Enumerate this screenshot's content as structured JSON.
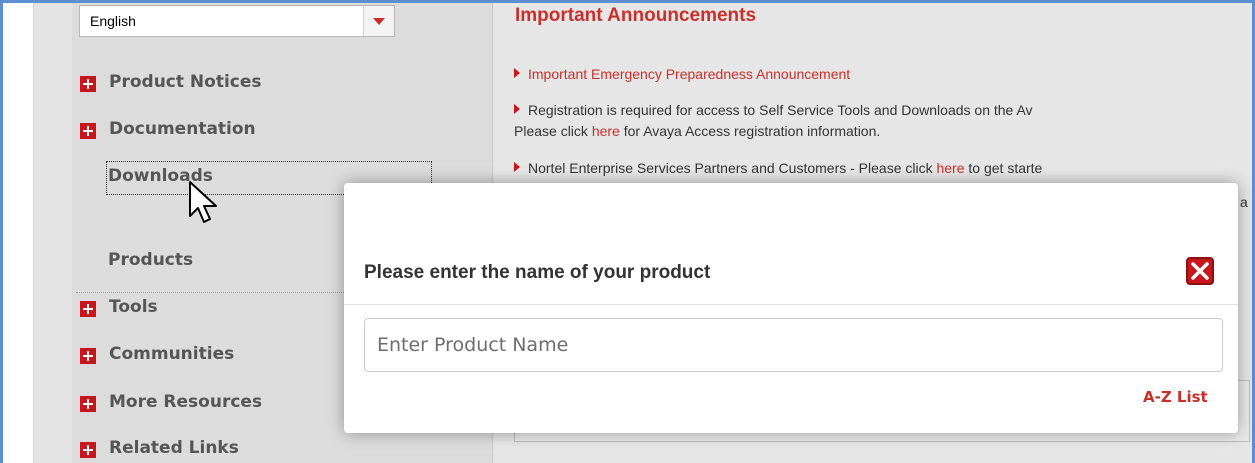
{
  "sidebar": {
    "language": "English",
    "nav_items": [
      {
        "label": "Product Notices"
      },
      {
        "label": "Documentation"
      }
    ],
    "sub_items": [
      {
        "label": "Downloads"
      },
      {
        "label": "Products"
      }
    ],
    "lower_items": [
      {
        "label": "Tools"
      },
      {
        "label": "Communities"
      },
      {
        "label": "More Resources"
      },
      {
        "label": "Related Links"
      }
    ]
  },
  "announcements": {
    "title": "Important Announcements",
    "line1": "Important Emergency Preparedness Announcement",
    "line2a": "Registration is required for access to Self Service Tools and Downloads on the Av",
    "line2b_pre": "Please click ",
    "line2b_link": "here",
    "line2b_post": " for Avaya Access registration information.",
    "line3_pre": "Nortel Enterprise Services Partners and Customers - Please click ",
    "line3_link": "here",
    "line3_post": " to get starte",
    "line4_peek": "a"
  },
  "modal": {
    "title": "Please enter the name of your product",
    "input_placeholder": "Enter Product Name",
    "az_link": "A-Z List"
  },
  "colors": {
    "accent_red": "#c9302c",
    "frame_blue": "#5b8fd1"
  }
}
